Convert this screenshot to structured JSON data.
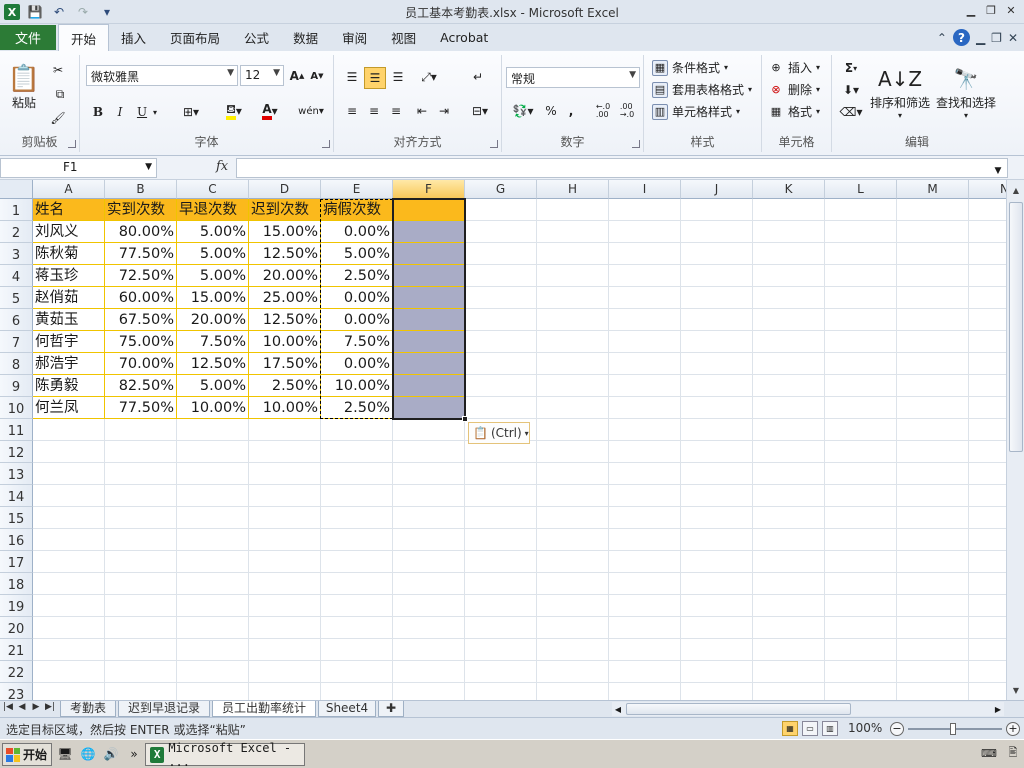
{
  "titlebar": {
    "title": "员工基本考勤表.xlsx - Microsoft Excel",
    "app_icon": "X"
  },
  "ribbon_tabs": {
    "file": "文件",
    "items": [
      "开始",
      "插入",
      "页面布局",
      "公式",
      "数据",
      "审阅",
      "视图",
      "Acrobat"
    ],
    "active_index": 0
  },
  "ribbon": {
    "clipboard": {
      "label": "剪贴板",
      "paste": "粘贴"
    },
    "font": {
      "label": "字体",
      "font_name": "微软雅黑",
      "font_size": "12",
      "bold": "B",
      "italic": "I",
      "underline": "U",
      "font_color_glyph": "A",
      "wen": "wén"
    },
    "alignment": {
      "label": "对齐方式"
    },
    "number": {
      "label": "数字",
      "format": "常规",
      "percent": "%",
      "comma": ",",
      "inc_dec": ".0 .00",
      "dec_dec": ".00 .0"
    },
    "styles": {
      "label": "样式",
      "conditional": "条件格式",
      "table_format": "套用表格格式",
      "cell_styles": "单元格样式"
    },
    "cells": {
      "label": "单元格",
      "insert": "插入",
      "delete": "删除",
      "format": "格式"
    },
    "editing": {
      "label": "编辑",
      "sigma": "Σ",
      "sort_filter": "排序和筛选",
      "find_select": "查找和选择"
    }
  },
  "formula_bar": {
    "name_box": "F1",
    "fx": "fx",
    "content": ""
  },
  "grid": {
    "columns": [
      "A",
      "B",
      "C",
      "D",
      "E",
      "F",
      "G",
      "H",
      "I",
      "J",
      "K",
      "L",
      "M",
      "N"
    ],
    "rows": [
      "1",
      "2",
      "3",
      "4",
      "5",
      "6",
      "7",
      "8",
      "9",
      "10",
      "11",
      "12",
      "13",
      "14",
      "15",
      "16",
      "17",
      "18",
      "19",
      "20",
      "21",
      "22",
      "23"
    ],
    "header": [
      "姓名",
      "实到次数",
      "早退次数",
      "迟到次数",
      "病假次数",
      ""
    ],
    "data": [
      [
        "刘风义",
        "80.00%",
        "5.00%",
        "15.00%",
        "0.00%"
      ],
      [
        "陈秋菊",
        "77.50%",
        "5.00%",
        "12.50%",
        "5.00%"
      ],
      [
        "蒋玉珍",
        "72.50%",
        "5.00%",
        "20.00%",
        "2.50%"
      ],
      [
        "赵俏茹",
        "60.00%",
        "15.00%",
        "25.00%",
        "0.00%"
      ],
      [
        "黄茹玉",
        "67.50%",
        "20.00%",
        "12.50%",
        "0.00%"
      ],
      [
        "何哲宇",
        "75.00%",
        "7.50%",
        "10.00%",
        "7.50%"
      ],
      [
        "郝浩宇",
        "70.00%",
        "12.50%",
        "17.50%",
        "0.00%"
      ],
      [
        "陈勇毅",
        "82.50%",
        "5.00%",
        "2.50%",
        "10.00%"
      ],
      [
        "何兰凤",
        "77.50%",
        "10.00%",
        "10.00%",
        "2.50%"
      ]
    ],
    "paste_options": "(Ctrl)",
    "colors": {
      "header_fill": "#fbb91c",
      "selection_fill": "#a9acc6",
      "data_border": "#f0c400"
    }
  },
  "sheets": {
    "tabs": [
      "考勤表",
      "迟到早退记录",
      "员工出勤率统计",
      "Sheet4"
    ],
    "active_index": 2
  },
  "status": {
    "message": "选定目标区域，然后按 ENTER 或选择“粘贴”",
    "zoom": "100%"
  },
  "taskbar": {
    "start": "开始",
    "window": "Microsoft Excel - ..."
  }
}
